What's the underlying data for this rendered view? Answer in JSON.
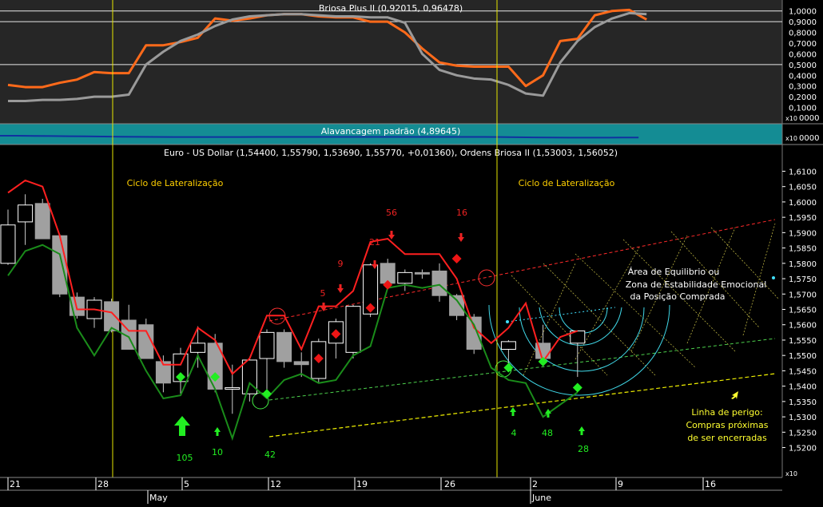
{
  "panels": {
    "osc_title": "Briosa Plus II (0,92015, 0,96478)",
    "mid_title": "Alavancagem padrão (4,89645)",
    "main_title": "Euro - US Dollar (1,54400, 1,55790, 1,53690, 1,55770, +0,01360), Ordens Briosa II (1,53003, 1,56052)",
    "x10_osc": "x10",
    "x10_mid": "x10",
    "x10_main": "x10",
    "mid_axis_label": "0000",
    "osc_zero_label": "0000"
  },
  "annotations": {
    "ciclo_left": "Ciclo de Lateralização",
    "ciclo_right": "Ciclo de Lateralização",
    "area_line1": "Área de Equilibrio ou",
    "area_line2": "Zona de Estabilidade Emocional",
    "area_line3": "da Posição Comprada",
    "perigo_line1": "Linha de perigo:",
    "perigo_line2": "Compras próximas",
    "perigo_line3": "de ser encerradas",
    "green_numbers": [
      "105",
      "10",
      "42",
      "4",
      "48",
      "28"
    ],
    "red_numbers": [
      "5",
      "9",
      "21",
      "56",
      "16"
    ]
  },
  "x_axis": {
    "ticks": [
      "21",
      "28",
      "5",
      "12",
      "19",
      "26",
      "2",
      "9",
      "16"
    ],
    "months": [
      "May",
      "June"
    ]
  },
  "chart_data": [
    {
      "type": "line",
      "title": "Briosa Plus II (0,92015, 0,96478)",
      "y_ticks": [
        "1,0000",
        "0,9000",
        "0,8000",
        "0,7000",
        "0,6000",
        "0,5000",
        "0,4000",
        "0,3000",
        "0,2000",
        "0,1000"
      ],
      "ylim": [
        0.0,
        1.08
      ],
      "reference_lines": [
        1.0,
        0.9,
        0.5
      ],
      "series": [
        {
          "color": "#ff6a1a",
          "values": [
            0.31,
            0.29,
            0.29,
            0.33,
            0.36,
            0.43,
            0.42,
            0.42,
            0.68,
            0.68,
            0.71,
            0.75,
            0.93,
            0.91,
            0.93,
            0.96,
            0.97,
            0.97,
            0.95,
            0.94,
            0.94,
            0.9,
            0.9,
            0.8,
            0.65,
            0.52,
            0.49,
            0.48,
            0.48,
            0.48,
            0.3,
            0.4,
            0.72,
            0.74,
            0.96,
            1.0,
            1.01,
            0.92
          ]
        },
        {
          "color": "#9a9a9a",
          "values": [
            0.16,
            0.16,
            0.17,
            0.17,
            0.18,
            0.2,
            0.2,
            0.22,
            0.5,
            0.62,
            0.72,
            0.78,
            0.86,
            0.92,
            0.95,
            0.96,
            0.97,
            0.97,
            0.96,
            0.95,
            0.95,
            0.94,
            0.94,
            0.89,
            0.6,
            0.45,
            0.4,
            0.37,
            0.36,
            0.31,
            0.23,
            0.21,
            0.52,
            0.72,
            0.85,
            0.93,
            0.98,
            0.97
          ]
        }
      ]
    },
    {
      "type": "line",
      "title": "Alavancagem padrão (4,89645)",
      "series": [
        {
          "color": "#1030a0",
          "values": [
            0.0,
            0.0,
            -0.3,
            -0.4,
            -0.6,
            -0.8,
            -1.0,
            -1.2,
            -1.4,
            -1.5,
            -1.6,
            -1.6,
            -1.6,
            -1.6,
            -1.6,
            -1.5,
            -1.5,
            -1.5,
            -1.5,
            -1.5,
            -1.5,
            -1.5,
            -1.5,
            -1.5,
            -1.5,
            -1.5,
            -1.5,
            -1.5,
            -1.5,
            -1.6,
            -1.9,
            -2.1,
            -2.3,
            -2.4,
            -2.4,
            -2.4,
            -2.3,
            -2.3
          ]
        }
      ]
    },
    {
      "type": "candlestick",
      "title": "Euro - US Dollar (1,54400, 1,55790, 1,53690, 1,55770, +0,01360), Ordens Briosa II (1,53003, 1,56052)",
      "y_ticks": [
        "1,6100",
        "1,6050",
        "1,6000",
        "1,5950",
        "1,5900",
        "1,5850",
        "1,5800",
        "1,5750",
        "1,5700",
        "1,5650",
        "1,5600",
        "1,5550",
        "1,5500",
        "1,5450",
        "1,5400",
        "1,5350",
        "1,5300",
        "1,5250",
        "1,5200"
      ],
      "ylim": [
        1.5165,
        1.6135
      ],
      "candles": [
        {
          "o": 1.58,
          "h": 1.5975,
          "l": 1.5795,
          "c": 1.5925
        },
        {
          "o": 1.5935,
          "h": 1.6025,
          "l": 1.586,
          "c": 1.599
        },
        {
          "o": 1.5995,
          "h": 1.601,
          "l": 1.588,
          "c": 1.588
        },
        {
          "o": 1.589,
          "h": 1.5895,
          "l": 1.569,
          "c": 1.57
        },
        {
          "o": 1.569,
          "h": 1.5705,
          "l": 1.562,
          "c": 1.563
        },
        {
          "o": 1.562,
          "h": 1.569,
          "l": 1.559,
          "c": 1.568
        },
        {
          "o": 1.5675,
          "h": 1.5685,
          "l": 1.5575,
          "c": 1.558
        },
        {
          "o": 1.5615,
          "h": 1.5665,
          "l": 1.552,
          "c": 1.552
        },
        {
          "o": 1.56,
          "h": 1.562,
          "l": 1.549,
          "c": 1.549
        },
        {
          "o": 1.548,
          "h": 1.55,
          "l": 1.538,
          "c": 1.541
        },
        {
          "o": 1.5415,
          "h": 1.5525,
          "l": 1.5375,
          "c": 1.5505
        },
        {
          "o": 1.551,
          "h": 1.5595,
          "l": 1.546,
          "c": 1.554
        },
        {
          "o": 1.554,
          "h": 1.557,
          "l": 1.538,
          "c": 1.539
        },
        {
          "o": 1.539,
          "h": 1.547,
          "l": 1.531,
          "c": 1.5395
        },
        {
          "o": 1.5375,
          "h": 1.549,
          "l": 1.535,
          "c": 1.5485
        },
        {
          "o": 1.549,
          "h": 1.5585,
          "l": 1.539,
          "c": 1.5575
        },
        {
          "o": 1.5575,
          "h": 1.5585,
          "l": 1.546,
          "c": 1.548
        },
        {
          "o": 1.548,
          "h": 1.551,
          "l": 1.543,
          "c": 1.547
        },
        {
          "o": 1.5425,
          "h": 1.5555,
          "l": 1.541,
          "c": 1.5545
        },
        {
          "o": 1.554,
          "h": 1.562,
          "l": 1.549,
          "c": 1.561
        },
        {
          "o": 1.551,
          "h": 1.5665,
          "l": 1.549,
          "c": 1.566
        },
        {
          "o": 1.5635,
          "h": 1.58,
          "l": 1.5625,
          "c": 1.5795
        },
        {
          "o": 1.58,
          "h": 1.5815,
          "l": 1.572,
          "c": 1.5735
        },
        {
          "o": 1.5735,
          "h": 1.578,
          "l": 1.571,
          "c": 1.577
        },
        {
          "o": 1.577,
          "h": 1.578,
          "l": 1.575,
          "c": 1.5765
        },
        {
          "o": 1.5775,
          "h": 1.58,
          "l": 1.5675,
          "c": 1.5695
        },
        {
          "o": 1.5695,
          "h": 1.57,
          "l": 1.5615,
          "c": 1.563
        },
        {
          "o": 1.5625,
          "h": 1.5635,
          "l": 1.5505,
          "c": 1.552
        },
        {
          "o": 1.552,
          "h": 1.555,
          "l": 1.5475,
          "c": 1.5545
        },
        {
          "o": 1.554,
          "h": 1.56,
          "l": 1.548,
          "c": 1.549
        },
        {
          "o": 1.554,
          "h": 1.558,
          "l": 1.543,
          "c": 1.558
        }
      ],
      "candle_slots": [
        0,
        1,
        2,
        3,
        4,
        5,
        6,
        7,
        8,
        9,
        10,
        11,
        12,
        13,
        14,
        15,
        16,
        17,
        18,
        19,
        20,
        21,
        22,
        23,
        24,
        25,
        26,
        27,
        29,
        31,
        33
      ],
      "red_line": [
        1.603,
        1.607,
        1.605,
        1.589,
        1.565,
        1.565,
        1.564,
        1.558,
        1.558,
        1.547,
        1.547,
        1.559,
        1.555,
        1.544,
        1.549,
        1.563,
        1.563,
        1.552,
        1.566,
        1.566,
        1.571,
        1.587,
        1.588,
        1.583,
        1.583,
        1.583,
        1.575,
        1.559,
        1.554,
        1.559,
        1.567,
        1.548,
        1.556,
        1.558
      ],
      "green_line": [
        1.576,
        1.584,
        1.586,
        1.583,
        1.559,
        1.55,
        1.559,
        1.556,
        1.545,
        1.536,
        1.537,
        1.55,
        1.539,
        1.523,
        1.541,
        1.536,
        1.542,
        1.544,
        1.541,
        1.542,
        1.55,
        1.553,
        1.572,
        1.573,
        1.572,
        1.573,
        1.568,
        1.56,
        1.546,
        1.542,
        1.541,
        1.53,
        1.534,
        1.538
      ]
    }
  ]
}
